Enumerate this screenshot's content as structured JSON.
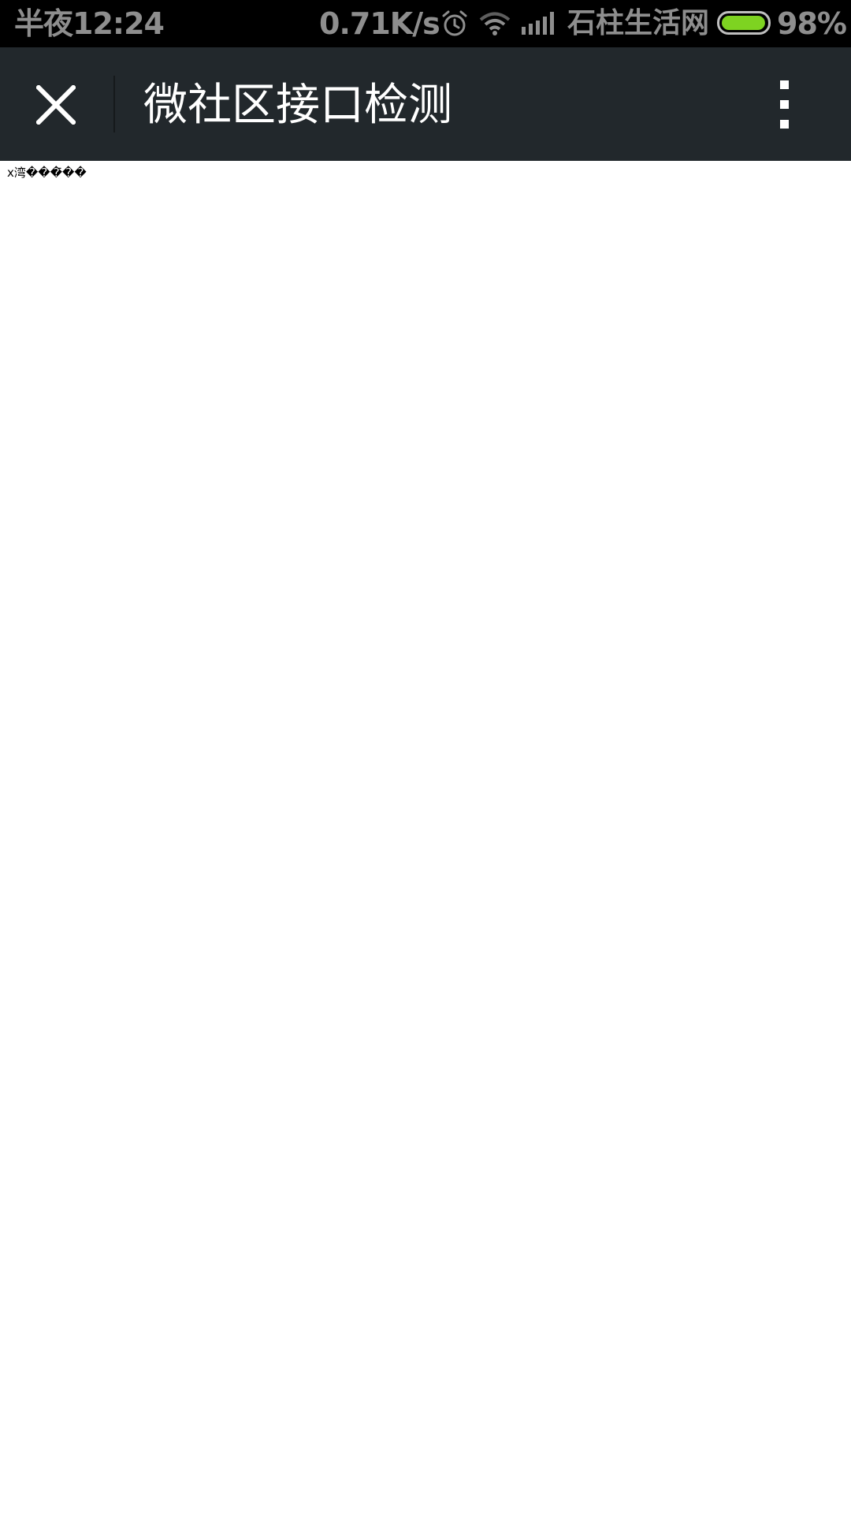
{
  "status_bar": {
    "time": "半夜12:24",
    "net_speed": "0.71K/s",
    "carrier": "石柱生活网",
    "battery_percent": "98%",
    "battery_level": 0.98,
    "battery_color": "#7ed321",
    "icons": [
      "alarm-icon",
      "wifi-icon",
      "signal-icon",
      "battery-icon"
    ]
  },
  "header": {
    "title": "微社区接口检测",
    "close_icon": "close-icon",
    "more_icon": "more-vertical-icon",
    "background": "#22282c"
  },
  "content": {
    "text": "x湾���̄̄��"
  }
}
